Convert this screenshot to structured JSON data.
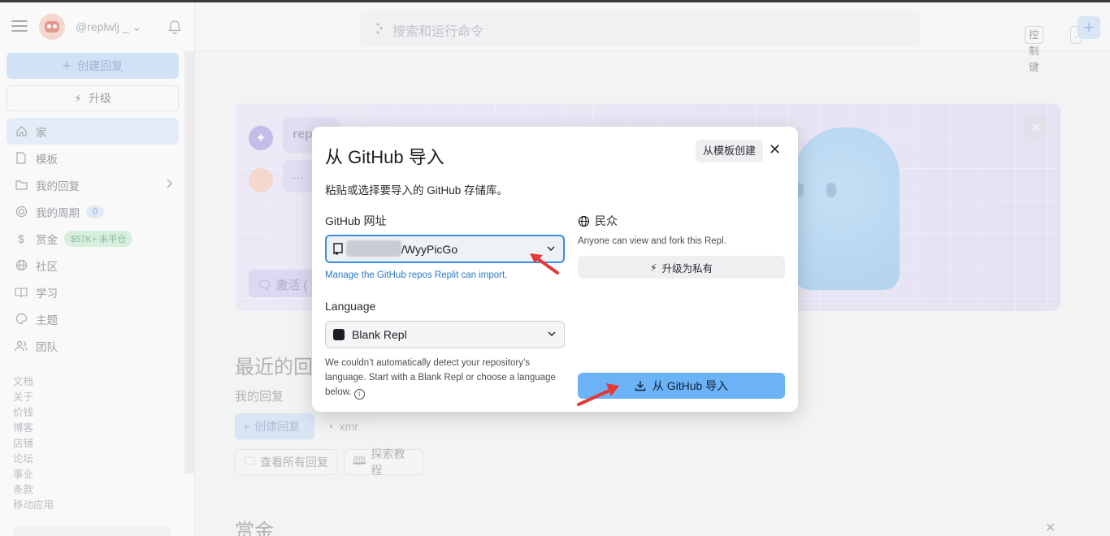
{
  "sidebar": {
    "username": "@replwlj _",
    "create_label": "创建回复",
    "upgrade_label": "升级",
    "nav": [
      {
        "label": "家"
      },
      {
        "label": "模板"
      },
      {
        "label": "我的回复"
      },
      {
        "label": "我的周期",
        "badge": "0"
      },
      {
        "label": "赏金",
        "badge": "$57K+ 未平仓"
      },
      {
        "label": "社区"
      },
      {
        "label": "学习"
      },
      {
        "label": "主题"
      },
      {
        "label": "团队"
      }
    ],
    "footer_links": [
      "文档",
      "关于",
      "价钱",
      "博客",
      "店铺",
      "论坛",
      "事业",
      "条款",
      "移动应用"
    ]
  },
  "header": {
    "search_placeholder": "搜索和运行命令",
    "kbd1": "控制键",
    "kbd2": ".",
    "plus": "+"
  },
  "main": {
    "bubble1": "rep",
    "bubble2": "...",
    "activate": "激活 (",
    "recent_title": "最近的回",
    "recent_sub": "我的回复",
    "create_label": "创建回复",
    "xmr_label": "xmr",
    "view_all": "查看所有回复",
    "tutorials": "探索教程",
    "bounties_title": "赏金"
  },
  "modal": {
    "title": "从 GitHub 导入",
    "template_button": "从模板创建",
    "description": "粘贴或选择要导入的 GitHub 存储库。",
    "url_label": "GitHub 网址",
    "url_value": "/WyyPicGo",
    "manage_link": "Manage the GitHub repos Replit can import.",
    "language_label": "Language",
    "language_value": "Blank Repl",
    "note": "We couldn’t automatically detect your repository’s language. Start with a Blank Repl or choose a language below.",
    "public_label": "民众",
    "public_desc": "Anyone can view and fork this Repl.",
    "private_button": "升级为私有",
    "import_button": "从 GitHub 导入"
  },
  "colors": {
    "accent": "#6cb2f6",
    "link": "#2b78c6",
    "annotation_arrow": "#e53935"
  }
}
